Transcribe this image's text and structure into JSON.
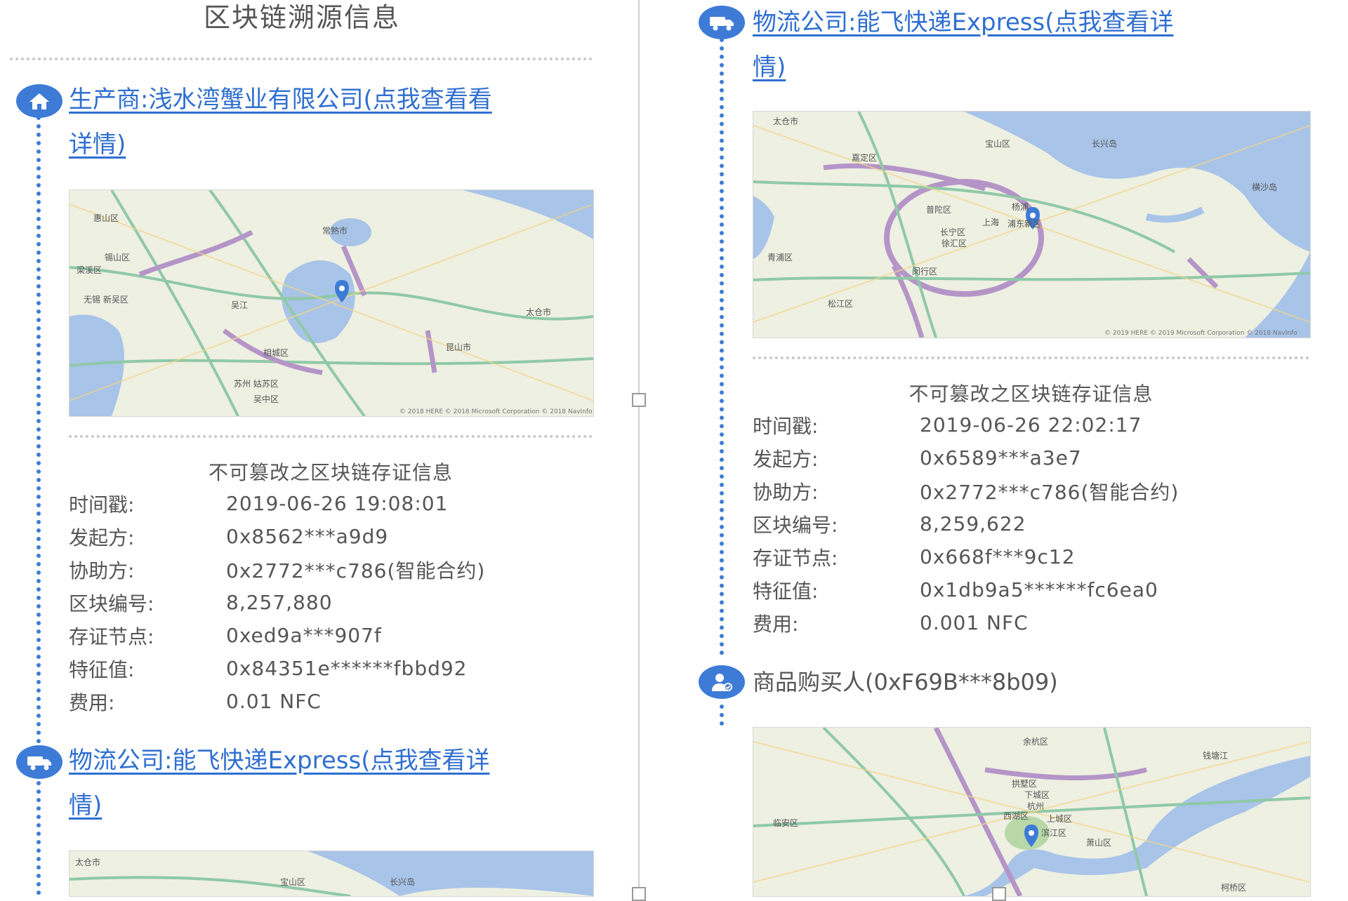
{
  "page_title": "区块链溯源信息",
  "info_heading": "不可篡改之区块链存证信息",
  "labels": {
    "timestamp": "时间戳:",
    "initiator": "发起方:",
    "assistant": "协助方:",
    "block_no": "区块编号:",
    "node": "存证节点:",
    "feature": "特征值:",
    "fee": "费用:"
  },
  "left": {
    "producer_link": "生产商:浅水湾蟹业有限公司(点我查看看详情)",
    "producer_link_line1": "生产商:浅水湾蟹业有限公司(点我查看看",
    "producer_link_line2": "详情)",
    "record": {
      "timestamp": "2019-06-26 19:08:01",
      "initiator": "0x8562***a9d9",
      "assistant": "0x2772***c786(智能合约)",
      "block_no": "8,257,880",
      "node": "0xed9a***907f",
      "feature": "0x84351e******fbbd92",
      "fee": "0.01 NFC"
    },
    "logistics_link_line1": "物流公司:能飞快递Express(点我查看详",
    "logistics_link_line2": "情)"
  },
  "right": {
    "logistics_link_line1": "物流公司:能飞快递Express(点我查看详",
    "logistics_link_line2": "情)",
    "record": {
      "timestamp": "2019-06-26 22:02:17",
      "initiator": "0x6589***a3e7",
      "assistant": "0x2772***c786(智能合约)",
      "block_no": "8,259,622",
      "node": "0x668f***9c12",
      "feature": "0x1db9a5******fc6ea0",
      "fee": "0.001 NFC"
    },
    "buyer": "商品购买人(0xF69B***8b09)"
  },
  "maps": {
    "wuxi": {
      "labels": [
        "惠山区",
        "常熟市",
        "梁溪区",
        "锡山区",
        "无锡 新吴区",
        "吴江",
        "昆山市",
        "太仓市",
        "苏州 姑苏区",
        "相城区",
        "吴中区"
      ],
      "copyright": "© 2018 HERE © 2018 Microsoft Corporation © 2018 NavInfo"
    },
    "shanghai": {
      "labels": [
        "太仓市",
        "宝山区",
        "嘉定区",
        "长兴岛",
        "杨浦",
        "上海",
        "浦东新区",
        "普陀区",
        "长宁区",
        "徐汇区",
        "闵行区",
        "青浦区",
        "松江区",
        "横沙岛"
      ],
      "copyright": "© 2019 HERE © 2019 Microsoft Corporation © 2018 NavInfo"
    },
    "hangzhou": {
      "labels": [
        "余杭区",
        "钱塘江",
        "拱墅区",
        "下城区",
        "杭州",
        "西湖区",
        "上城区",
        "临安区",
        "滨江区",
        "萧山区",
        "柯桥区"
      ]
    },
    "partial": {
      "labels": [
        "太仓市",
        "宝山区",
        "长兴岛"
      ]
    }
  },
  "colors": {
    "accent": "#3d7bd6",
    "link": "#2f6fd0"
  }
}
